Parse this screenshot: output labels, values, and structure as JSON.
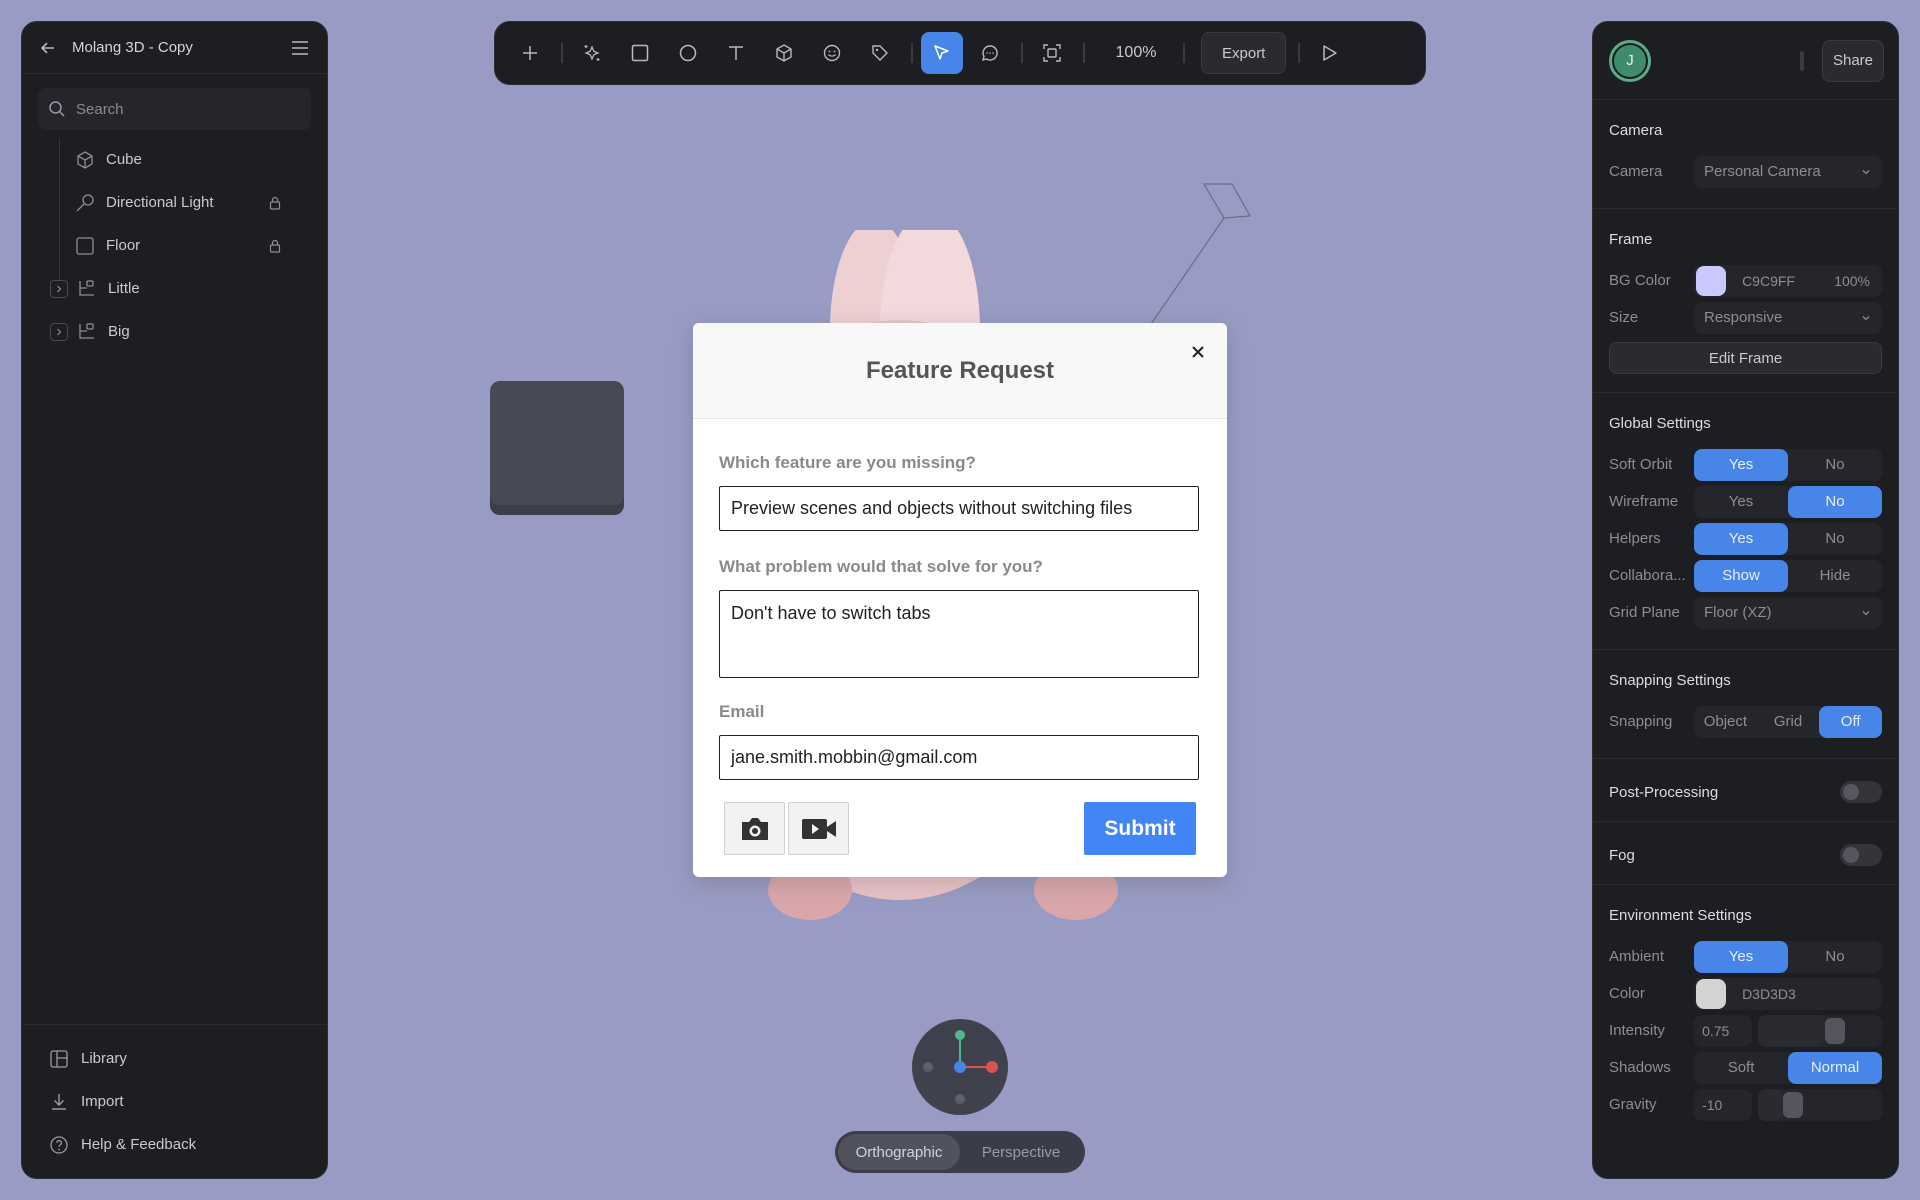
{
  "left_panel": {
    "title": "Molang 3D - Copy",
    "search_placeholder": "Search",
    "layers": [
      {
        "label": "Cube"
      },
      {
        "label": "Directional Light"
      },
      {
        "label": "Floor"
      },
      {
        "label": "Little"
      },
      {
        "label": "Big"
      }
    ],
    "footer": {
      "library": "Library",
      "import": "Import",
      "help": "Help & Feedback"
    }
  },
  "toolbar": {
    "zoom": "100%",
    "export_label": "Export"
  },
  "right_panel": {
    "avatar_initial": "J",
    "share_label": "Share",
    "camera": {
      "title": "Camera",
      "camera_label": "Camera",
      "camera_value": "Personal Camera"
    },
    "frame": {
      "title": "Frame",
      "bg_color_label": "BG Color",
      "bg_color_hex": "C9C9FF",
      "bg_color_swatch": "#c9c9ff",
      "bg_opacity": "100%",
      "size_label": "Size",
      "size_value": "Responsive",
      "edit_frame": "Edit Frame"
    },
    "global": {
      "title": "Global Settings",
      "soft_orbit_label": "Soft Orbit",
      "wireframe_label": "Wireframe",
      "helpers_label": "Helpers",
      "collab_label": "Collabora...",
      "grid_plane_label": "Grid Plane",
      "grid_plane_value": "Floor (XZ)",
      "yes": "Yes",
      "no": "No",
      "show": "Show",
      "hide": "Hide"
    },
    "snapping": {
      "title": "Snapping Settings",
      "label": "Snapping",
      "object": "Object",
      "grid": "Grid",
      "off": "Off"
    },
    "post_processing": "Post-Processing",
    "fog": "Fog",
    "environment": {
      "title": "Environment Settings",
      "ambient_label": "Ambient",
      "color_label": "Color",
      "color_hex": "D3D3D3",
      "color_swatch": "#d3d3d3",
      "intensity_label": "Intensity",
      "intensity_value": "0.75",
      "shadows_label": "Shadows",
      "soft": "Soft",
      "normal": "Normal",
      "gravity_label": "Gravity",
      "gravity_value": "-10"
    }
  },
  "projection": {
    "orthographic": "Orthographic",
    "perspective": "Perspective"
  },
  "modal": {
    "title": "Feature Request",
    "q1": "Which feature are you missing?",
    "a1": "Preview scenes and objects without switching files",
    "q2": "What problem would that solve for you?",
    "a2": "Don't have to switch tabs",
    "email_label": "Email",
    "email_value": "jane.smith.mobbin@gmail.com",
    "submit": "Submit"
  },
  "colors": {
    "accent": "#4785e8",
    "canvas_bg": "#989cc4",
    "panel_bg": "#1d1e22",
    "submit_blue": "#4285f4"
  }
}
